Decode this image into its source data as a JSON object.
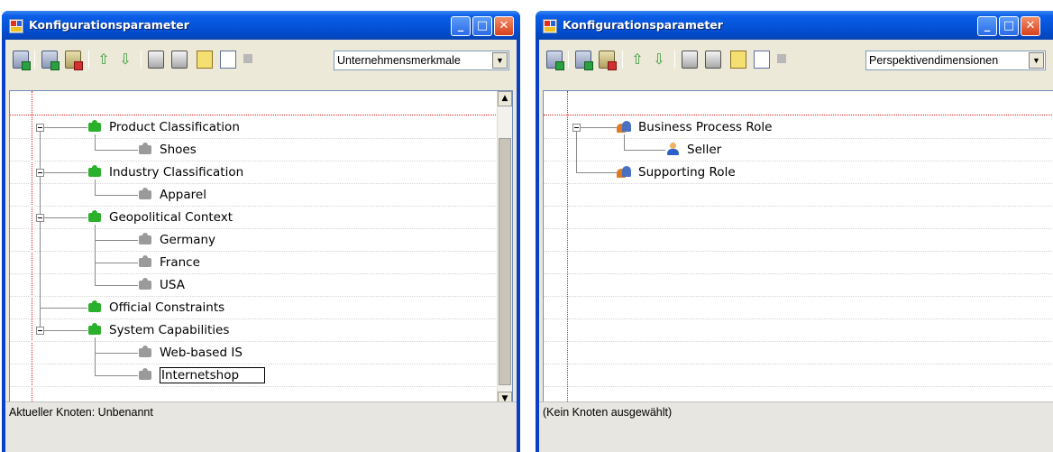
{
  "windows": [
    {
      "title": "Konfigurationsparameter",
      "dropdown": "Unternehmensmerkmale",
      "status": "Aktueller Knoten: Unbenannt",
      "tree": [
        {
          "label": "Product Classification",
          "children": [
            {
              "label": "Shoes"
            }
          ]
        },
        {
          "label": "Industry Classification",
          "children": [
            {
              "label": "Apparel"
            }
          ]
        },
        {
          "label": "Geopolitical Context",
          "children": [
            {
              "label": "Germany"
            },
            {
              "label": "France"
            },
            {
              "label": "USA"
            }
          ]
        },
        {
          "label": "Official Constraints"
        },
        {
          "label": "System Capabilities",
          "children": [
            {
              "label": "Web-based IS"
            },
            {
              "label": "Internetshop"
            }
          ]
        }
      ]
    },
    {
      "title": "Konfigurationsparameter",
      "dropdown": "Perspektivendimensionen",
      "status": "(Kein Knoten ausgewählt)",
      "tree": [
        {
          "label": "Business Process Role",
          "children": [
            {
              "label": "Seller"
            }
          ]
        },
        {
          "label": "Supporting Role"
        }
      ]
    }
  ],
  "icons": {
    "app": "app-window-icon",
    "toolbar": [
      "add-node-icon",
      "add-child-icon",
      "delete-node-icon",
      "move-up-icon",
      "move-down-icon",
      "print-icon",
      "print-preview-icon",
      "book-icon",
      "document-icon",
      "stop-icon"
    ],
    "node_left": "puzzle-piece-icon",
    "node_right": "users-icon"
  },
  "colors": {
    "titlebar": "#0453d8",
    "frame": "#ece9d8",
    "guide_line": "#e02020",
    "puzzle_parent": "#2ab02a",
    "puzzle_child": "#9a9a9a"
  }
}
